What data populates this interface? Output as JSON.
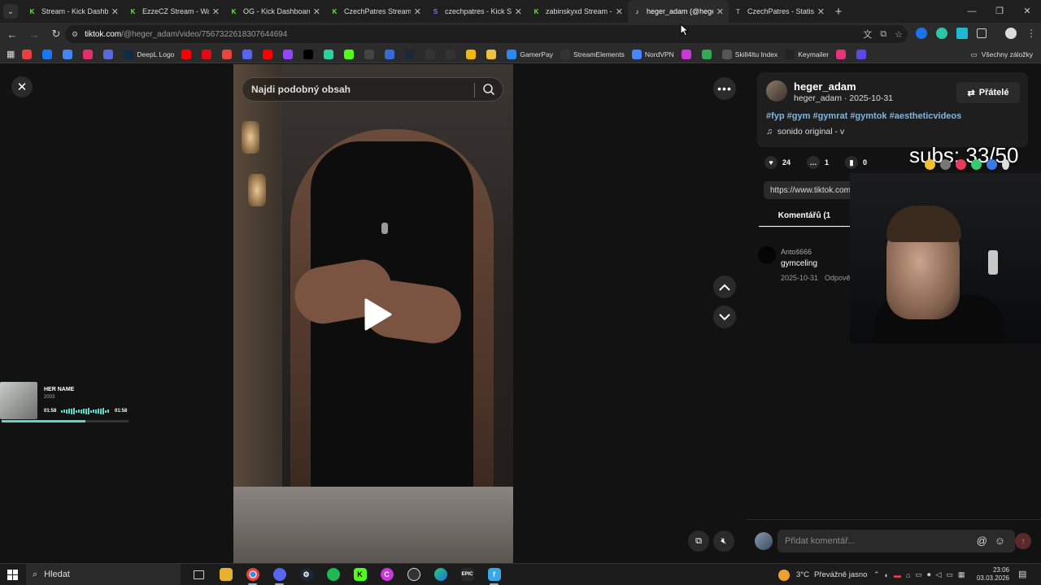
{
  "browser": {
    "tabs": [
      {
        "title": "Stream - Kick Dashbo",
        "fav": "K",
        "color": "#53fc18",
        "active": false
      },
      {
        "title": "EzzeCZ Stream - Wat",
        "fav": "K",
        "color": "#53fc18",
        "active": false
      },
      {
        "title": "OG - Kick Dashboard",
        "fav": "K",
        "color": "#53fc18",
        "active": false
      },
      {
        "title": "CzechPatres Stream -",
        "fav": "K",
        "color": "#53fc18",
        "active": false
      },
      {
        "title": "czechpatres - Kick St",
        "fav": "S",
        "color": "#8a6aff",
        "active": false
      },
      {
        "title": "zabinskyxd Stream - ",
        "fav": "K",
        "color": "#53fc18",
        "active": false
      },
      {
        "title": "heger_adam (@hege",
        "fav": "♪",
        "color": "#ffffff",
        "active": true
      },
      {
        "title": "CzechPatres - Statisti",
        "fav": "T",
        "color": "#2ad2a2",
        "active": false
      }
    ],
    "url_host": "tiktok.com",
    "url_path": "/@heger_adam/video/7567322618307644694",
    "bookmarks": [
      {
        "label": "",
        "color": "#e84040"
      },
      {
        "label": "",
        "color": "#1877f2"
      },
      {
        "label": "",
        "color": "#4285f4"
      },
      {
        "label": "",
        "color": "#e1306c"
      },
      {
        "label": "",
        "color": "#5a6ad8"
      },
      {
        "label": "DeepL Logo",
        "color": "#0f2b46"
      },
      {
        "label": "",
        "color": "#ff0000"
      },
      {
        "label": "",
        "color": "#e50914"
      },
      {
        "label": "",
        "color": "#e8453c"
      },
      {
        "label": "",
        "color": "#5865f2"
      },
      {
        "label": "",
        "color": "#ff0000"
      },
      {
        "label": "",
        "color": "#9146ff"
      },
      {
        "label": "",
        "color": "#000000"
      },
      {
        "label": "",
        "color": "#2ad2a2"
      },
      {
        "label": "",
        "color": "#53fc18"
      },
      {
        "label": "",
        "color": "#444444"
      },
      {
        "label": "",
        "color": "#3a6ad8"
      },
      {
        "label": "",
        "color": "#1b2838"
      },
      {
        "label": "",
        "color": "#333333"
      },
      {
        "label": "",
        "color": "#333333"
      },
      {
        "label": "",
        "color": "#f0b90b"
      },
      {
        "label": "",
        "color": "#f0c040"
      },
      {
        "label": "GamerPay",
        "color": "#2a8af0"
      },
      {
        "label": "StreamElements",
        "color": "#333333"
      },
      {
        "label": "NordVPN",
        "color": "#4687ff"
      },
      {
        "label": "",
        "color": "#c83ad8"
      },
      {
        "label": "",
        "color": "#34a853"
      },
      {
        "label": "Skill4ltu Index",
        "color": "#555555"
      },
      {
        "label": "Keymailer",
        "color": "#222222"
      },
      {
        "label": "",
        "color": "#e8327c"
      },
      {
        "label": "",
        "color": "#5a4ae8"
      }
    ],
    "all_bookmarks": "Všechny záložky"
  },
  "video": {
    "search_placeholder": "Najdi podobný obsah"
  },
  "music_widget": {
    "title": "HER NAME",
    "year": "2003",
    "time_start": "01:58",
    "time_end": "01:58",
    "progress": 0.66
  },
  "post": {
    "username": "heger_adam",
    "sub": "heger_adam · 2025-10-31",
    "friends_label": "Přátelé",
    "hashtags": "#fyp #gym #gymrat #gymtok #aestheticvideos",
    "sound": "sonido original - v",
    "likes": "24",
    "comments": "1",
    "saves": "0",
    "link": "https://www.tiktok.com",
    "comments_tab": "Komentářů (1"
  },
  "comment": {
    "author": "Antoš666",
    "text": "gymceling",
    "date": "2025-10-31",
    "reply": "Odpově"
  },
  "comment_input": {
    "placeholder": "Přidat komentář..."
  },
  "overlay": {
    "subs": "subs: 33/50"
  },
  "taskbar": {
    "search": "Hledat",
    "temp": "3°C",
    "weather": "Převážně jasno",
    "time": "23:06",
    "date": "03.03.2026"
  },
  "colors": {
    "accent_hashtag": "#7fb7e0",
    "music_progress": "#5ad8c8"
  }
}
